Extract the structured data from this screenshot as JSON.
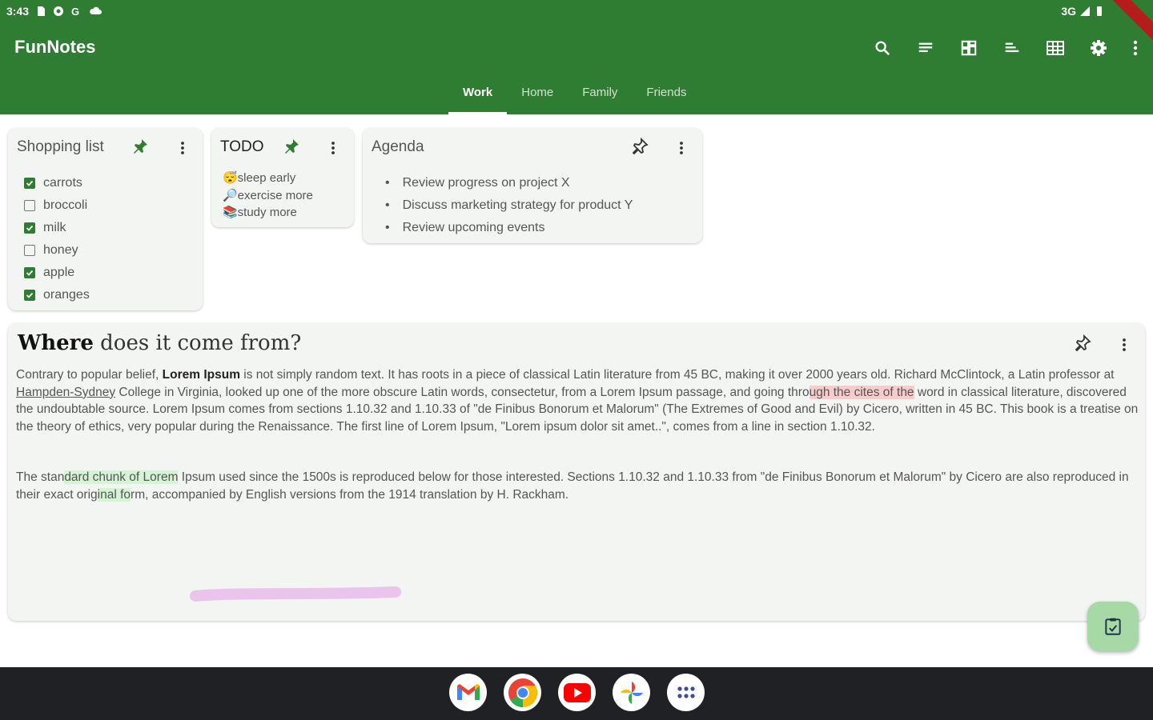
{
  "status_bar": {
    "time": "3:43",
    "network": "3G"
  },
  "app": {
    "title": "FunNotes"
  },
  "toolbar": {
    "icons": [
      "search-icon",
      "list-view-icon",
      "grid-view-icon",
      "sort-icon",
      "table-view-icon",
      "settings-icon",
      "more-vert-icon"
    ]
  },
  "tabs": [
    {
      "label": "Work",
      "active": true
    },
    {
      "label": "Home",
      "active": false
    },
    {
      "label": "Family",
      "active": false
    },
    {
      "label": "Friends",
      "active": false
    }
  ],
  "notes": {
    "shopping": {
      "title": "Shopping list",
      "pinned": true,
      "items": [
        {
          "label": "carrots",
          "checked": true
        },
        {
          "label": "broccoli",
          "checked": false
        },
        {
          "label": "milk",
          "checked": true
        },
        {
          "label": "honey",
          "checked": false
        },
        {
          "label": "apple",
          "checked": true
        },
        {
          "label": "oranges",
          "checked": true
        }
      ]
    },
    "todo": {
      "title": "TODO",
      "pinned": true,
      "lines": [
        "😴sleep early",
        "🔎exercise more",
        "📚study more"
      ]
    },
    "agenda": {
      "title": "Agenda",
      "pinned": false,
      "items": [
        "Review progress on project X",
        "Discuss marketing strategy for product Y",
        "Review upcoming events"
      ]
    },
    "article": {
      "title_bold": "Where",
      "title_rest": " does it come from?",
      "p1": {
        "t1": "Contrary to popular belief, ",
        "bold": "Lorem Ipsum",
        "t2": " is not simply random text. It has roots in a piece of classical Latin literature from 45 BC, making it over 2000 years old. Richard McClintock, a Latin professor at ",
        "link": "Hampden-Sydney",
        "t3": " College in Virginia, looked up one of the more obscure Latin words, consectetur, from a Lorem Ipsum passage, and going thro",
        "hl": "ugh the cites of the",
        "t4": " word in classical literature, discovered the undoubtable source. Lorem Ipsum comes from sections 1.10.32 and 1.10.33 of \"de Finibus Bonorum et Malorum\" (The Extremes of Good and Evil) by Cicero, written in 45 BC. This book is a treatise on the theory of ethics, very popular during the Renaissance. The first line of Lorem Ipsum, \"Lorem ipsum dolor sit amet..\", comes from a line in section 1.10.32."
      },
      "p2": {
        "t1": "The stan",
        "hl1": "dard chunk of Lorem",
        "t2": " Ipsum used since the 1500s is reproduced below for those interested. Sections 1.10.32 and 1.10.33 from \"de Finibus Bonorum et Malorum\" by Cicero are also reproduced in their exact orig",
        "hl2": "inal fo",
        "t3": "rm, accompanied by English versions from the 1914 translation by H. Rackham."
      }
    }
  },
  "colors": {
    "primary": "#2e7d32",
    "card": "#f3f5f3",
    "fab": "#a6d9a6",
    "highlight_red": "#f8cccc",
    "highlight_green": "#d5f3d5",
    "scribble": "#ebc4ee"
  },
  "dock": [
    "gmail-icon",
    "chrome-icon",
    "youtube-icon",
    "photos-icon",
    "app-drawer-icon"
  ]
}
